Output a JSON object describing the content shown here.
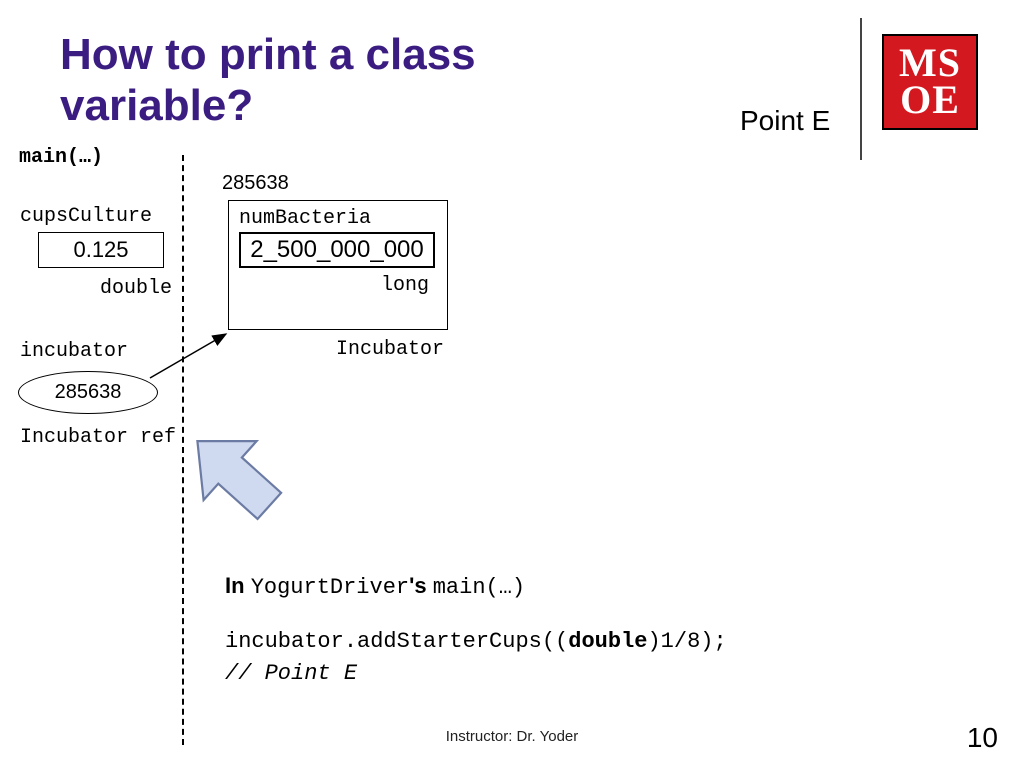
{
  "title": "How to print a class variable?",
  "point_label": "Point E",
  "logo": {
    "row1": "MS",
    "row2": "OE"
  },
  "main_label": "main(…)",
  "cups": {
    "label": "cupsCulture",
    "value": "0.125",
    "type": "double"
  },
  "heap_addr": "285638",
  "incubator_box": {
    "numb_label": "numBacteria",
    "numb_value": "2_500_000_000",
    "numb_type": "long"
  },
  "incubator_class": "Incubator",
  "incubator_var": {
    "label": "incubator",
    "value": "285638",
    "type": "Incubator ref"
  },
  "code": {
    "in": "In",
    "yd": "YogurtDriver",
    "poss": "'s",
    "mainw": "main(…)",
    "line2_pre": "incubator.addStarterCups((",
    "double_kw": "double",
    "line2_post": ")1/8);",
    "comment": "// Point E"
  },
  "footer": "Instructor: Dr. Yoder",
  "slide_num": "10"
}
